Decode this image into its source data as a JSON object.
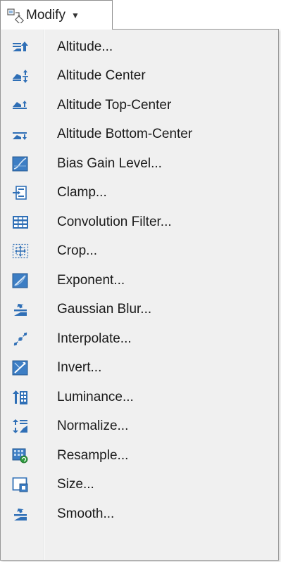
{
  "toolbar": {
    "button_label": "Modify",
    "button_icon": "modify-icon",
    "caret_icon": "caret-down-icon"
  },
  "menu": {
    "items": [
      {
        "label": "Altitude...",
        "icon": "altitude-icon"
      },
      {
        "label": "Altitude Center",
        "icon": "altitude-center-icon"
      },
      {
        "label": "Altitude Top-Center",
        "icon": "altitude-top-center-icon"
      },
      {
        "label": "Altitude Bottom-Center",
        "icon": "altitude-bottom-center-icon"
      },
      {
        "label": "Bias Gain Level...",
        "icon": "bias-gain-level-icon"
      },
      {
        "label": "Clamp...",
        "icon": "clamp-icon"
      },
      {
        "label": "Convolution Filter...",
        "icon": "convolution-filter-icon"
      },
      {
        "label": "Crop...",
        "icon": "crop-icon"
      },
      {
        "label": "Exponent...",
        "icon": "exponent-icon"
      },
      {
        "label": "Gaussian Blur...",
        "icon": "gaussian-blur-icon"
      },
      {
        "label": "Interpolate...",
        "icon": "interpolate-icon"
      },
      {
        "label": "Invert...",
        "icon": "invert-icon"
      },
      {
        "label": "Luminance...",
        "icon": "luminance-icon"
      },
      {
        "label": "Normalize...",
        "icon": "normalize-icon"
      },
      {
        "label": "Resample...",
        "icon": "resample-icon"
      },
      {
        "label": "Size...",
        "icon": "size-icon"
      },
      {
        "label": "Smooth...",
        "icon": "smooth-icon"
      }
    ]
  },
  "colors": {
    "menu_background": "#f0f0f0",
    "border": "#979797",
    "icon_blue": "#2f6fb6",
    "icon_green": "#2e9a3e"
  }
}
